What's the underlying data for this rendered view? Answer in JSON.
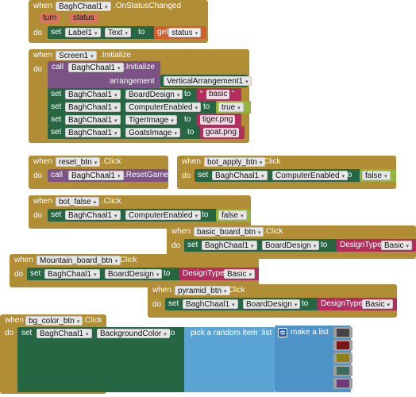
{
  "kw": {
    "when": "when",
    "do": "do",
    "set": "set",
    "to": "to",
    "call": "call",
    "get": "get",
    "arrow": "▾"
  },
  "b1": {
    "component": "BaghChaal1",
    "event": ".OnStatusChanged",
    "param1": "turn",
    "param2": "status",
    "target": "Label1",
    "prop": "Text",
    "getvar": "status"
  },
  "b2": {
    "component": "Screen1",
    "event": ".Initialize",
    "callcomp": "BaghChaal1",
    "method": ".Initialize",
    "arglabel": "arrangement",
    "argval": "VerticalArrangement1",
    "rows": [
      {
        "comp": "BaghChaal1",
        "prop": "BoardDesign",
        "value": "basic"
      },
      {
        "comp": "BaghChaal1",
        "prop": "ComputerEnabled",
        "value": "true"
      },
      {
        "comp": "BaghChaal1",
        "prop": "TigerImage",
        "value": "tiger.png"
      },
      {
        "comp": "BaghChaal1",
        "prop": "GoatsImage",
        "value": "goat.png"
      }
    ]
  },
  "b3": {
    "component": "reset_btn",
    "event": ".Click",
    "callcomp": "BaghChaal1",
    "method": ".ResetGame"
  },
  "b4": {
    "component": "bot_apply_btn",
    "event": ".Click",
    "comp": "BaghChaal1",
    "prop": "ComputerEnabled",
    "value": "false"
  },
  "b5": {
    "component": "bot_false",
    "event": ".Click",
    "comp": "BaghChaal1",
    "prop": "ComputerEnabled",
    "value": "false"
  },
  "b6": {
    "component": "basic_board_btn",
    "event": ".Click",
    "comp": "BaghChaal1",
    "prop": "BoardDesign",
    "helper": "DesignType",
    "helperval": "Basic"
  },
  "b7": {
    "component": "Mountain_board_btn",
    "event": ".Click",
    "comp": "BaghChaal1",
    "prop": "BoardDesign",
    "helper": "DesignType",
    "helperval": "Basic"
  },
  "b8": {
    "component": "pyramid_btn",
    "event": ".Click",
    "comp": "BaghChaal1",
    "prop": "BoardDesign",
    "helper": "DesignType",
    "helperval": "Basic"
  },
  "b9": {
    "component": "bg_color_btn",
    "event": ".Click",
    "comp": "BaghChaal1",
    "prop": "BackgroundColor",
    "pick": "pick a random item  list",
    "makelist": "make a list"
  },
  "colors": [
    "#444444",
    "#7a1414",
    "#8c8219",
    "#3f6b5f",
    "#6b3a78"
  ]
}
